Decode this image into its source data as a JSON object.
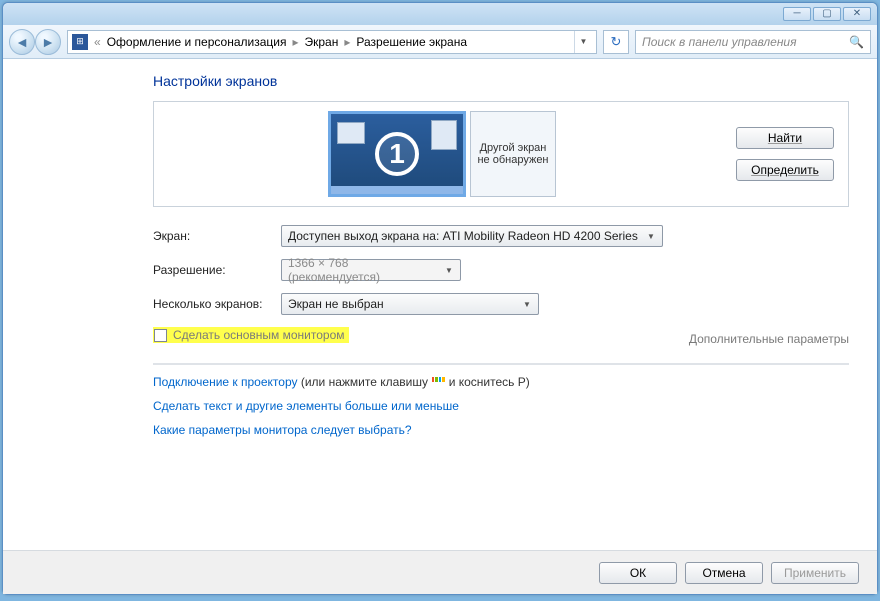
{
  "breadcrumb": {
    "prefix": "«",
    "items": [
      "Оформление и персонализация",
      "Экран",
      "Разрешение экрана"
    ]
  },
  "search": {
    "placeholder": "Поиск в панели управления"
  },
  "page": {
    "title": "Настройки экранов",
    "monitor_number": "1",
    "other_screen_label": "Другой экран не обнаружен",
    "btn_find": "Найти",
    "btn_detect": "Определить"
  },
  "form": {
    "display_label": "Экран:",
    "display_value": "Доступен выход экрана на: ATI Mobility Radeon HD 4200 Series",
    "resolution_label": "Разрешение:",
    "resolution_value": "1366 × 768 (рекомендуется)",
    "multi_label": "Несколько экранов:",
    "multi_value": "Экран не выбран",
    "checkbox_label": "Сделать основным монитором",
    "advanced_link": "Дополнительные параметры"
  },
  "links": {
    "projector_pre": "Подключение к проектору",
    "projector_post": " (или нажмите клавишу ",
    "projector_tail": " и коснитесь P)",
    "text_size": "Сделать текст и другие элементы больше или меньше",
    "which_monitor": "Какие параметры монитора следует выбрать?"
  },
  "footer": {
    "ok": "ОК",
    "cancel": "Отмена",
    "apply": "Применить"
  }
}
